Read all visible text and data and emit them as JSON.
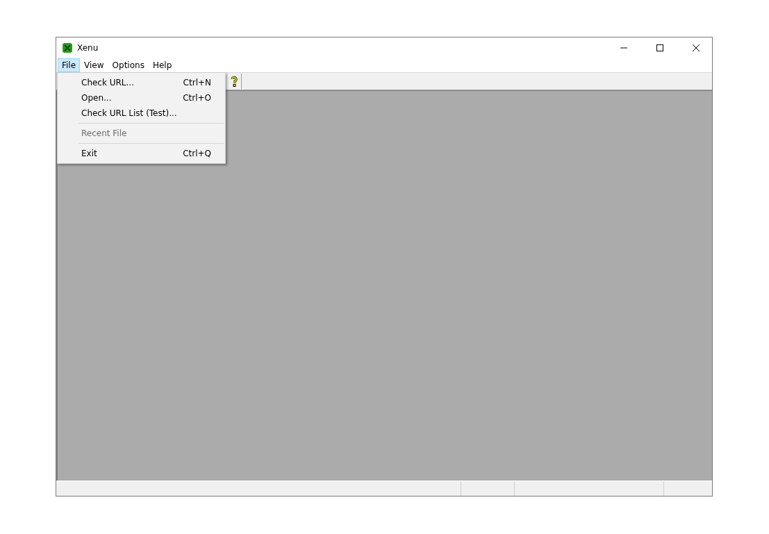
{
  "window": {
    "title": "Xenu"
  },
  "menubar": [
    {
      "label": "File",
      "selected": true
    },
    {
      "label": "View",
      "selected": false
    },
    {
      "label": "Options",
      "selected": false
    },
    {
      "label": "Help",
      "selected": false
    }
  ],
  "file_menu": [
    {
      "kind": "item",
      "label": "Check URL...",
      "shortcut": "Ctrl+N",
      "disabled": false
    },
    {
      "kind": "item",
      "label": "Open...",
      "shortcut": "Ctrl+O",
      "disabled": false
    },
    {
      "kind": "item",
      "label": "Check URL List (Test)...",
      "disabled": false
    },
    {
      "kind": "separator"
    },
    {
      "kind": "item",
      "label": "Recent File",
      "disabled": true
    },
    {
      "kind": "separator"
    },
    {
      "kind": "item",
      "label": "Exit",
      "shortcut": "Ctrl+Q",
      "disabled": false
    }
  ]
}
